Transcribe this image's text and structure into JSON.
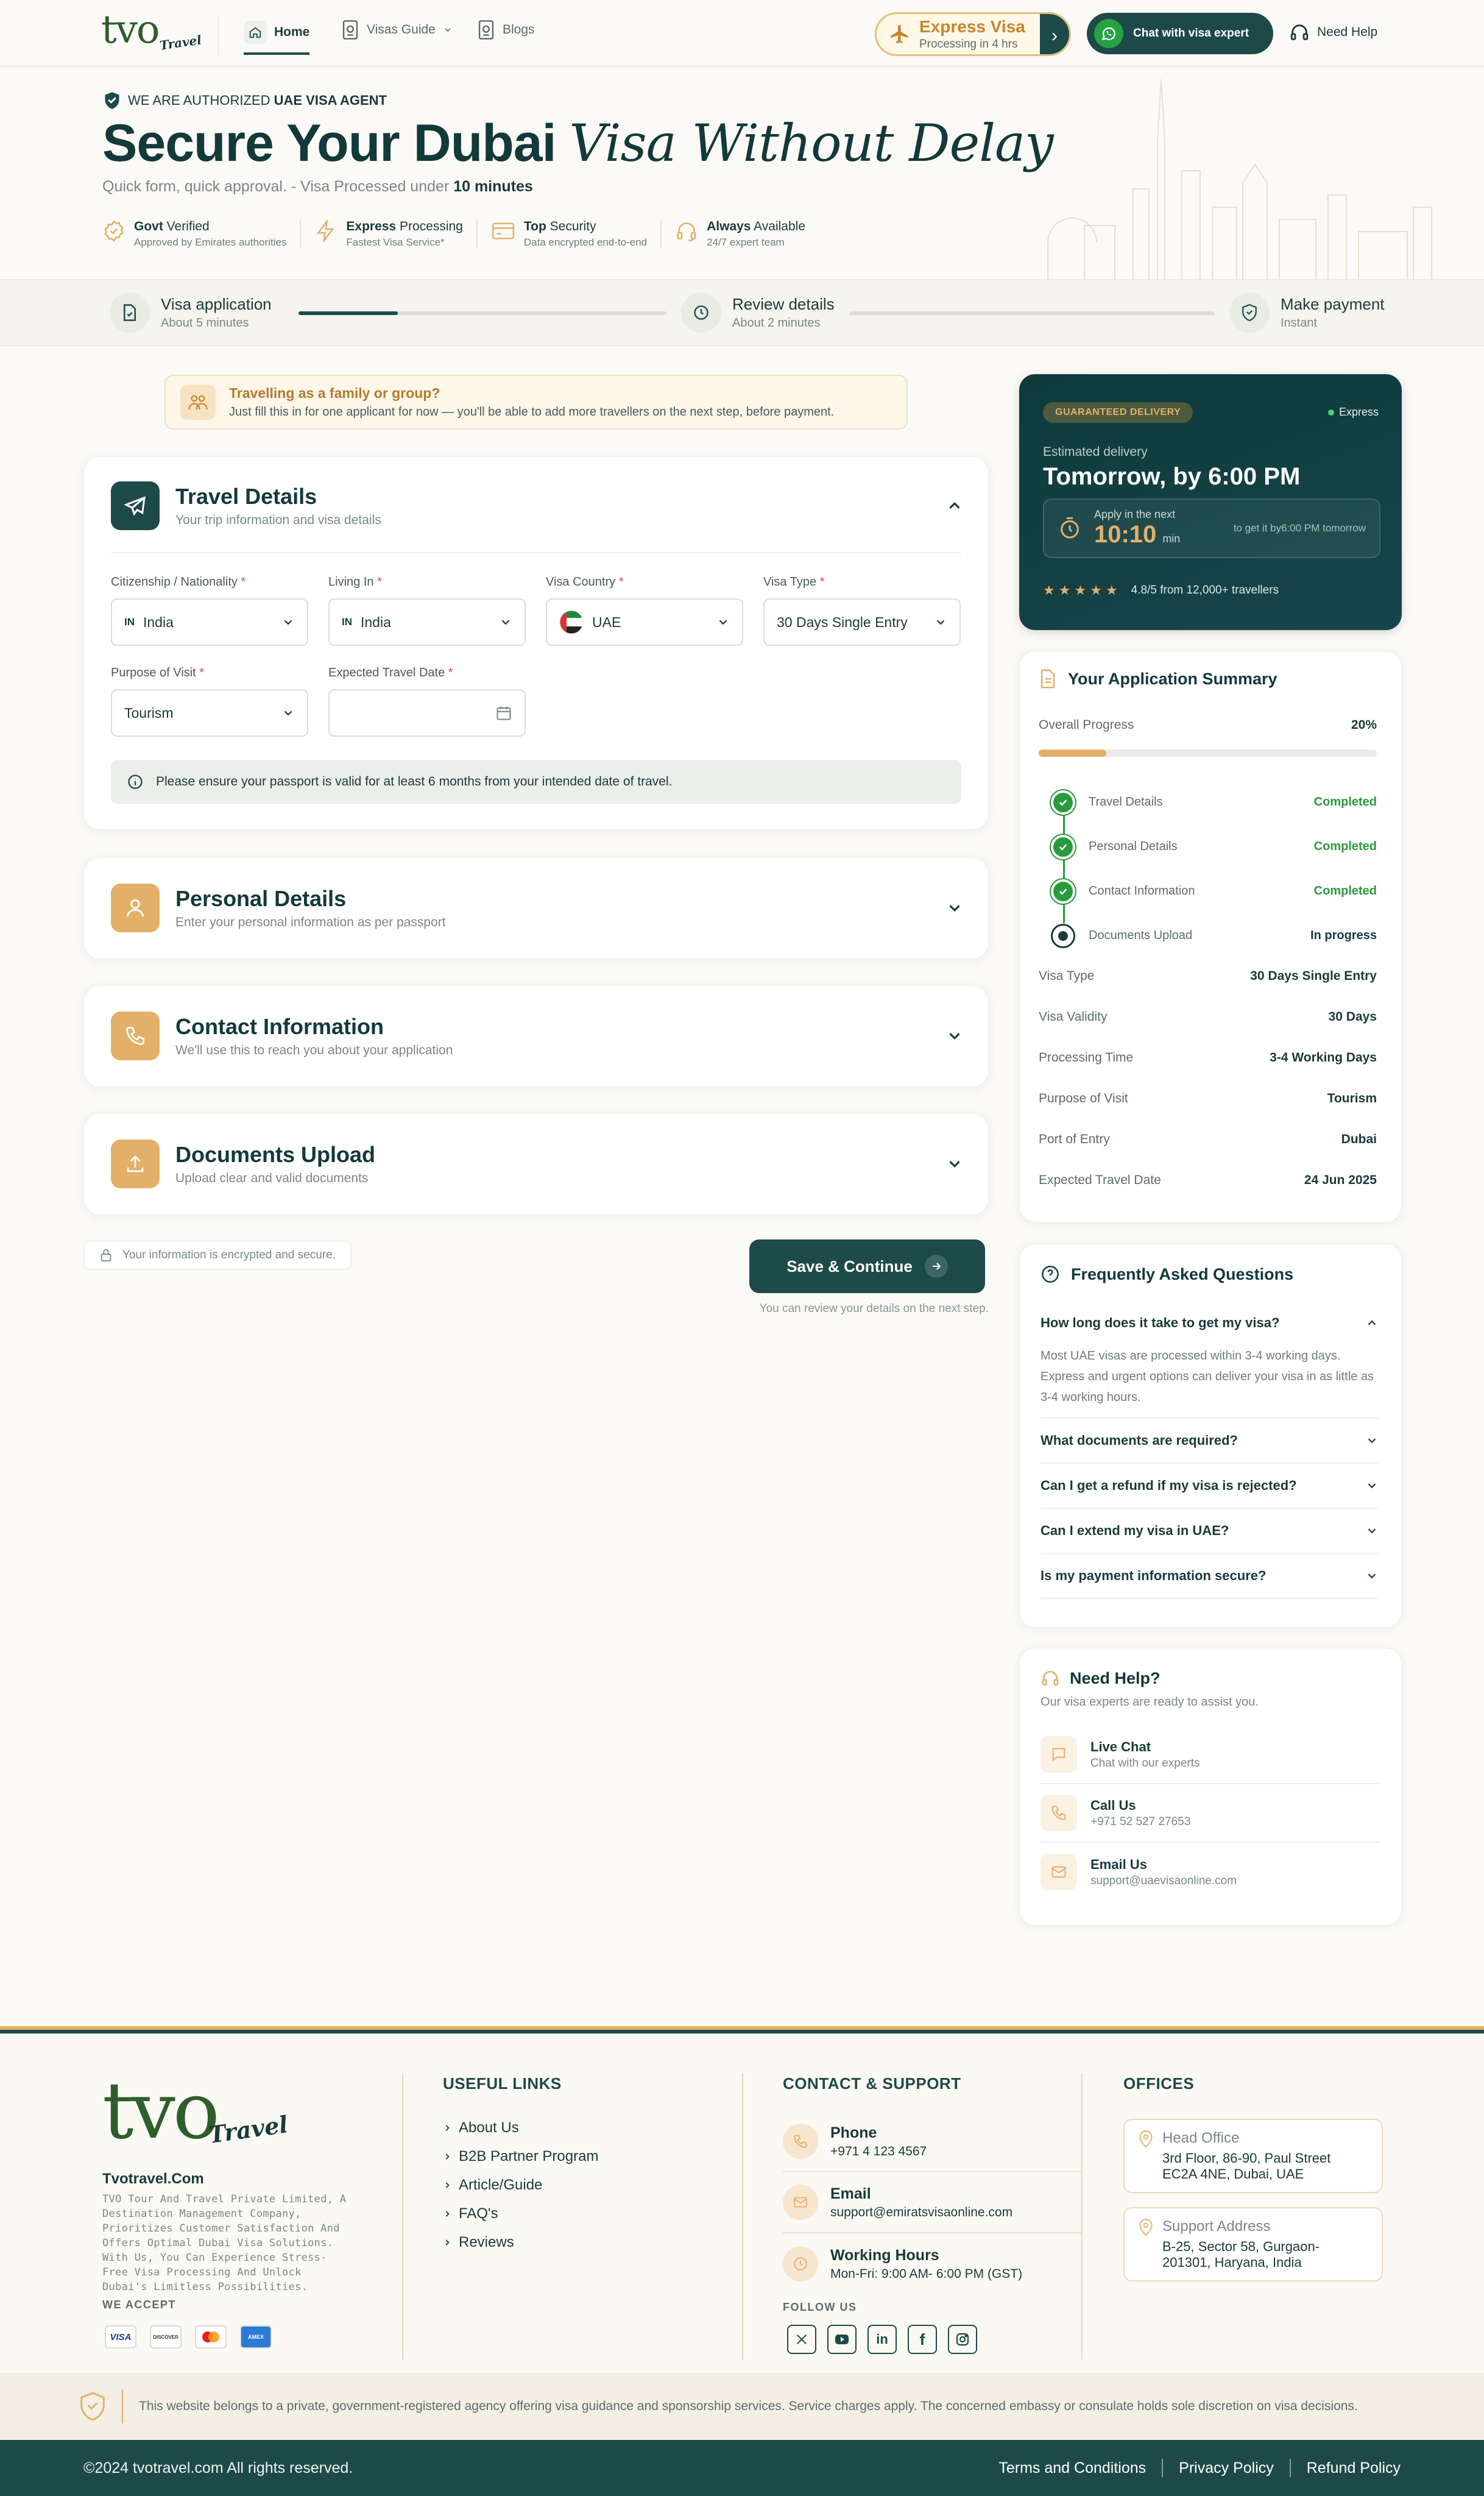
{
  "header": {
    "logo_text": "tvo",
    "logo_script": "Travel",
    "nav": [
      {
        "label": "Home",
        "icon": "home-icon"
      },
      {
        "label": "Visas Guide",
        "icon": "passport-icon"
      },
      {
        "label": "Blogs",
        "icon": "blog-icon"
      }
    ],
    "express": {
      "title": "Express Visa",
      "subtitle": "Processing in 4 hrs"
    },
    "chat_label": "Chat with visa expert",
    "help_label": "Need Help"
  },
  "hero": {
    "authorized_prefix": "WE ARE AUTHORIZED ",
    "authorized_strong": "UAE VISA AGENT",
    "title_bold": "Secure Your Dubai",
    "title_italic": "Visa Without Delay",
    "subtitle_prefix": "Quick form, quick approval. - Visa Processed under ",
    "subtitle_strong": "10 minutes",
    "badges": [
      {
        "strong": "Govt",
        "rest": " Verified",
        "sub": "Approved by Emirates authorities"
      },
      {
        "strong": "Express",
        "rest": " Processing",
        "sub": "Fastest Visa Service*"
      },
      {
        "strong": "Top",
        "rest": " Security",
        "sub": "Data encrypted end-to-end"
      },
      {
        "strong": "Always",
        "rest": " Available",
        "sub": "24/7 expert team"
      }
    ]
  },
  "stepper": {
    "steps": [
      {
        "title": "Visa application",
        "sub": "About 5 minutes"
      },
      {
        "title": "Review details",
        "sub": "About 2 minutes"
      },
      {
        "title": "Make payment",
        "sub": "Instant"
      }
    ],
    "progress_fraction": 0.27
  },
  "notice": {
    "title": "Travelling as a family or group?",
    "text": "Just fill this in for one applicant for now — you'll be able to add more travellers on the next step, before payment."
  },
  "travel": {
    "title": "Travel Details",
    "subtitle": "Your trip information and visa details",
    "fields": {
      "citizenship": {
        "label": "Citizenship / Nationality",
        "code": "IN",
        "value": "India"
      },
      "living_in": {
        "label": "Living In",
        "code": "IN",
        "value": "India"
      },
      "visa_country": {
        "label": "Visa Country",
        "value": "UAE"
      },
      "visa_type": {
        "label": "Visa Type",
        "value": "30 Days Single Entry"
      },
      "purpose": {
        "label": "Purpose of Visit",
        "value": "Tourism"
      },
      "travel_date": {
        "label": "Expected Travel Date",
        "value": ""
      }
    },
    "required_mark": "*",
    "info": "Please ensure your passport is valid for at least 6 months from your intended date of travel."
  },
  "sections": [
    {
      "title": "Personal Details",
      "subtitle": "Enter your personal information as per passport"
    },
    {
      "title": "Contact Information",
      "subtitle": "We'll use this to reach you about your application"
    },
    {
      "title": "Documents Upload",
      "subtitle": "Upload clear and valid documents"
    }
  ],
  "secure_note": "Your information is encrypted and secure.",
  "save_label": "Save & Continue",
  "review_note": "You can review your details on the next step.",
  "delivery": {
    "tag": "GUARANTEED DELIVERY",
    "mode": "Express",
    "est_label": "Estimated delivery",
    "est_value": "Tomorrow, by 6:00 PM",
    "apply_label": "Apply in the next",
    "countdown": "10:10",
    "countdown_unit": "min",
    "deadline": "to get it by6:00 PM tomorrow",
    "rating": "4.8/5 from 12,000+ travellers",
    "stars": 5
  },
  "summary": {
    "title": "Your Application Summary",
    "progress_label": "Overall Progress",
    "progress_value": "20%",
    "progress_fraction": 0.2,
    "steps": [
      {
        "label": "Travel Details",
        "status": "Completed"
      },
      {
        "label": "Personal Details",
        "status": "Completed"
      },
      {
        "label": "Contact Information",
        "status": "Completed"
      },
      {
        "label": "Documents Upload",
        "status": "In progress"
      }
    ],
    "rows": [
      {
        "k": "Visa Type",
        "v": "30 Days Single Entry"
      },
      {
        "k": "Visa Validity",
        "v": "30 Days"
      },
      {
        "k": "Processing Time",
        "v": "3-4 Working Days"
      },
      {
        "k": "Purpose of Visit",
        "v": "Tourism"
      },
      {
        "k": "Port of Entry",
        "v": "Dubai"
      },
      {
        "k": "Expected Travel Date",
        "v": "24 Jun 2025"
      }
    ]
  },
  "faq": {
    "title": "Frequently Asked Questions",
    "items": [
      {
        "q": "How long does it take to get my visa?",
        "a": "Most UAE visas are processed within 3-4 working days. Express and urgent options can deliver your visa in as little as 3-4 working hours."
      },
      {
        "q": "What documents are required?"
      },
      {
        "q": "Can I get a refund if my visa is rejected?"
      },
      {
        "q": "Can I extend my visa in UAE?"
      },
      {
        "q": "Is my payment information secure?"
      }
    ]
  },
  "help": {
    "title": "Need Help?",
    "subtitle": "Our visa experts are ready to assist you.",
    "items": [
      {
        "t": "Live Chat",
        "s": "Chat with our experts"
      },
      {
        "t": "Call Us",
        "s": "+971 52 527 27653"
      },
      {
        "t": "Email Us",
        "s": "support@uaevisaonline.com"
      }
    ]
  },
  "footer": {
    "brand": "Tvotravel.Com",
    "about": "TVO Tour And Travel Private Limited, A Destination Management Company, Prioritizes Customer Satisfaction And Offers Optimal Dubai Visa Solutions. With Us, You Can Experience Stress-Free Visa Processing And Unlock Dubai's Limitless Possibilities.",
    "accept_label": "WE ACCEPT",
    "cards": [
      "VISA",
      "DISCOVER",
      "MC",
      "AMEX"
    ],
    "links_title": "USEFUL LINKS",
    "links": [
      "About Us",
      "B2B Partner Program",
      "Article/Guide",
      "FAQ's",
      "Reviews"
    ],
    "contact_title": "CONTACT & SUPPORT",
    "contacts": [
      {
        "t": "Phone",
        "s": "+971 4 123 4567"
      },
      {
        "t": "Email",
        "s": "support@emiratsvisaonline.com"
      },
      {
        "t": "Working Hours",
        "s": "Mon-Fri: 9:00 AM- 6:00 PM (GST)"
      }
    ],
    "follow": "FOLLOW US",
    "offices_title": "OFFICES",
    "offices": [
      {
        "t": "Head Office",
        "s1": "3rd Floor, 86-90, Paul Street",
        "s2": "EC2A 4NE, Dubai, UAE"
      },
      {
        "t": "Support Address",
        "s1": "B-25, Sector 58, Gurgaon-",
        "s2": "201301, Haryana, India"
      }
    ],
    "disclaimer": "This website belongs to a private, government-registered agency offering visa guidance and sponsorship services. Service charges apply. The concerned embassy or consulate holds sole discretion on visa decisions.",
    "copyright": "©2024 tvotravel.com All rights reserved.",
    "bottom_links": [
      "Terms and Conditions",
      "Privacy Policy",
      "Refund Policy"
    ]
  },
  "colors": {
    "primary": "#1d4a48",
    "accent": "#e3b06a",
    "success": "#2a9a3e",
    "bg": "#fbfaf6"
  }
}
